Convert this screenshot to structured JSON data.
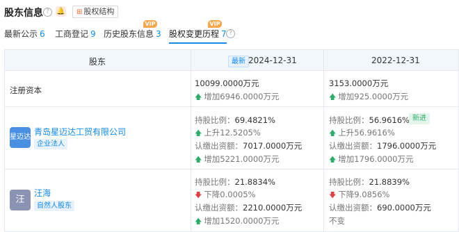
{
  "header": {
    "title": "股东信息",
    "help_glyph": "?",
    "bell_glyph": "🔔",
    "structure_button": "股权结构"
  },
  "tabs": [
    {
      "label": "最新公示",
      "count": "6"
    },
    {
      "label": "工商登记",
      "count": "9"
    },
    {
      "label": "历史股东信息",
      "count": "3"
    },
    {
      "label": "股权变更历程",
      "count": "7",
      "active": true
    }
  ],
  "vip_badge": "VIP",
  "table": {
    "col_shareholder": "股东",
    "latest_tag": "最新",
    "date1": "2024-12-31",
    "date2": "2022-12-31",
    "capital_row": {
      "label": "注册资本",
      "v1": "10099.0000万元",
      "v1_change": "增加6946.0000万元",
      "v2": "3153.0000万元",
      "v2_change": "增加925.0000万元"
    },
    "rows": [
      {
        "logo_text": "星迈达",
        "logo_color": "#4a90e2",
        "name": "青岛星迈达工贸有限公司",
        "type_tag": "企业法人",
        "p1_ratio_label": "持股比例：",
        "p1_ratio": "69.4821%",
        "p1_ratio_change": "上升12.5205%",
        "p1_sub_label": "认缴出资额：",
        "p1_sub": "7017.0000万元",
        "p1_sub_change": "增加5221.0000万元",
        "p2_ratio_label": "持股比例：",
        "p2_ratio": "56.9616%",
        "p2_new_tag": "新进",
        "p2_ratio_change": "上升56.9616%",
        "p2_sub_label": "认缴出资额：",
        "p2_sub": "1796.0000万元",
        "p2_sub_change": "增加1796.0000万元"
      },
      {
        "logo_text": "汪",
        "logo_color": "#8a93b3",
        "name": "汪海",
        "type_tag": "自然人股东",
        "p1_ratio_label": "持股比例：",
        "p1_ratio": "21.8834%",
        "p1_ratio_change": "下降0.0005%",
        "p1_sub_label": "认缴出资额：",
        "p1_sub": "2210.0000万元",
        "p1_sub_change": "增加1520.0000万元",
        "p2_ratio_label": "持股比例：",
        "p2_ratio": "21.8839%",
        "p2_ratio_change": "下降9.0856%",
        "p2_sub_label": "认缴出资额：",
        "p2_sub": "690.0000万元",
        "p2_sub_change": "不变"
      }
    ]
  },
  "glyphs": {
    "up": "🡅",
    "down": "🡇"
  },
  "colors": {
    "accent": "#128bed",
    "up": "#2eac6c",
    "down": "#e04040",
    "vip": "#f8a64a"
  }
}
